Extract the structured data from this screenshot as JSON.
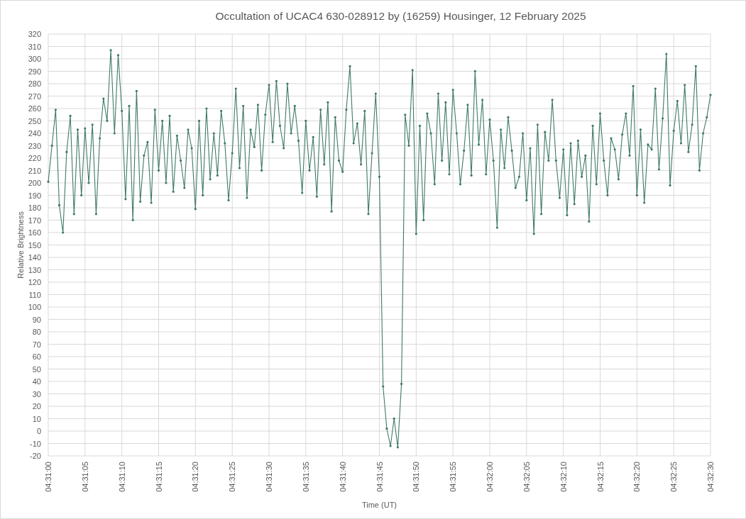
{
  "chart_data": {
    "type": "line",
    "title": "Occultation of UCAC4 630-028912 by (16259) Housinger, 12 February 2025",
    "xlabel": "Time (UT)",
    "ylabel": "Relative Brightness",
    "categories": [
      "04:31:00",
      null,
      null,
      null,
      null,
      null,
      null,
      null,
      null,
      null,
      "04:31:05",
      null,
      null,
      null,
      null,
      null,
      null,
      null,
      null,
      null,
      "04:31:10",
      null,
      null,
      null,
      null,
      null,
      null,
      null,
      null,
      null,
      "04:31:15",
      null,
      null,
      null,
      null,
      null,
      null,
      null,
      null,
      null,
      "04:31:20",
      null,
      null,
      null,
      null,
      null,
      null,
      null,
      null,
      null,
      "04:31:25",
      null,
      null,
      null,
      null,
      null,
      null,
      null,
      null,
      null,
      "04:31:30",
      null,
      null,
      null,
      null,
      null,
      null,
      null,
      null,
      null,
      "04:31:35",
      null,
      null,
      null,
      null,
      null,
      null,
      null,
      null,
      null,
      "04:31:40",
      null,
      null,
      null,
      null,
      null,
      null,
      null,
      null,
      null,
      "04:31:45",
      null,
      null,
      null,
      null,
      null,
      null,
      null,
      null,
      null,
      "04:31:50",
      null,
      null,
      null,
      null,
      null,
      null,
      null,
      null,
      null,
      "04:31:55",
      null,
      null,
      null,
      null,
      null,
      null,
      null,
      null,
      null,
      "04:32:00",
      null,
      null,
      null,
      null,
      null,
      null,
      null,
      null,
      null,
      "04:32:05",
      null,
      null,
      null,
      null,
      null,
      null,
      null,
      null,
      null,
      "04:32:10",
      null,
      null,
      null,
      null,
      null,
      null,
      null,
      null,
      null,
      "04:32:15",
      null,
      null,
      null,
      null,
      null,
      null,
      null,
      null,
      null,
      "04:32:20",
      null,
      null,
      null,
      null,
      null,
      null,
      null,
      null,
      null,
      "04:32:25",
      null,
      null,
      null,
      null,
      null,
      null,
      null,
      null,
      null,
      "04:32:30"
    ],
    "grid": true,
    "series": [
      {
        "color": "#3f7a66",
        "values": [
          201,
          230,
          259,
          182,
          160,
          225,
          254,
          175,
          243,
          190,
          244,
          200,
          247,
          175,
          236,
          268,
          250,
          307,
          240,
          303,
          258,
          187,
          262,
          170,
          274,
          185,
          222,
          233,
          184,
          259,
          210,
          250,
          200,
          254,
          193,
          238,
          218,
          196,
          243,
          228,
          179,
          250,
          190,
          260,
          203,
          240,
          206,
          258,
          232,
          186,
          224,
          276,
          212,
          262,
          188,
          243,
          229,
          263,
          210,
          255,
          279,
          233,
          282,
          246,
          228,
          280,
          240,
          262,
          234,
          192,
          250,
          210,
          237,
          189,
          259,
          215,
          265,
          177,
          253,
          218,
          209,
          259,
          294,
          232,
          248,
          215,
          258,
          175,
          224,
          272,
          205,
          36,
          2,
          -12,
          10,
          -13,
          38,
          255,
          230,
          291,
          159,
          246,
          170,
          256,
          240,
          199,
          272,
          218,
          265,
          207,
          275,
          240,
          199,
          226,
          263,
          206,
          290,
          231,
          267,
          207,
          251,
          218,
          164,
          243,
          212,
          253,
          226,
          196,
          205,
          240,
          186,
          228,
          159,
          247,
          175,
          241,
          218,
          267,
          218,
          188,
          227,
          174,
          232,
          183,
          234,
          205,
          222,
          169,
          246,
          199,
          256,
          218,
          190,
          236,
          227,
          203,
          239,
          256,
          222,
          278,
          190,
          243,
          184,
          231,
          227,
          276,
          211,
          252,
          304,
          198,
          242,
          266,
          232,
          279,
          225,
          247,
          294,
          210,
          240,
          253,
          271
        ]
      }
    ],
    "ylim": [
      -20,
      320
    ],
    "yticks": [
      -20,
      -10,
      0,
      10,
      20,
      30,
      40,
      50,
      60,
      70,
      80,
      90,
      100,
      110,
      120,
      130,
      140,
      150,
      160,
      170,
      180,
      190,
      200,
      210,
      220,
      230,
      240,
      250,
      260,
      270,
      280,
      290,
      300,
      310,
      320
    ]
  }
}
